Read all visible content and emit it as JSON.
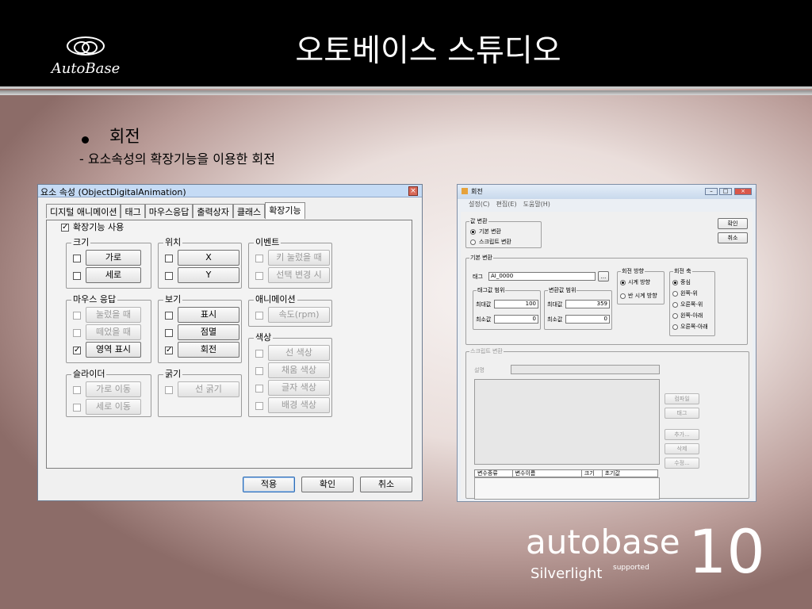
{
  "header": {
    "logo_text": "AutoBase",
    "title": "오토베이스 스튜디오"
  },
  "bullet": {
    "title": "회전",
    "subtitle": "- 요소속성의 확장기능을 이용한 회전"
  },
  "element_dialog": {
    "title": "요소 속성 (ObjectDigitalAnimation)",
    "close_icon": "close-icon",
    "tabs": [
      "디지털 애니메이션",
      "태그",
      "마우스응답",
      "출력상자",
      "클래스",
      "확장기능"
    ],
    "active_tab": "확장기능",
    "enable_extension": {
      "label": "확장기능 사용",
      "checked": true
    },
    "groups": {
      "size": {
        "title": "크기",
        "width": "가로",
        "height": "세로"
      },
      "position": {
        "title": "위치",
        "x": "X",
        "y": "Y"
      },
      "event": {
        "title": "이벤트",
        "key_press": "키 눌렀을 때",
        "selection_change": "선택 변경 시"
      },
      "mouse_response": {
        "title": "마우스 응답",
        "pressed": "눌렀을 때",
        "released": "떼었을 때",
        "area_display": "영역 표시"
      },
      "view": {
        "title": "보기",
        "display": "표시",
        "blink": "점멸",
        "rotate": "회전"
      },
      "animation": {
        "title": "애니메이션",
        "speed": "속도(rpm)"
      },
      "color": {
        "title": "색상",
        "line_color": "선 색상",
        "fill_color": "채움 색상",
        "text_color": "글자 색상",
        "background_color": "배경 색상"
      },
      "slider": {
        "title": "슬라이더",
        "horizontal_move": "가로 이동",
        "vertical_move": "세로 이동"
      },
      "thickness": {
        "title": "굵기",
        "line_thickness": "선 굵기"
      }
    },
    "buttons": {
      "apply": "적용",
      "ok": "확인",
      "cancel": "취소"
    }
  },
  "rotation_dialog": {
    "title": "회전",
    "menu": [
      "설정(C)",
      "편집(E)",
      "도움말(H)"
    ],
    "value_conversion": {
      "title": "값 변환",
      "basic": "기본 변환",
      "script": "스크립트 변환"
    },
    "buttons": {
      "ok": "확인",
      "cancel": "취소"
    },
    "basic_conversion": {
      "title": "기본 변환",
      "tag_label": "태그",
      "tag_value": "AI_0000",
      "browse": "...",
      "tag_range": {
        "title": "태그값 범위",
        "max_label": "최대값",
        "max_value": "100",
        "min_label": "최소값",
        "min_value": "0"
      },
      "convert_range": {
        "title": "변환값 범위",
        "max_label": "최대값",
        "max_value": "359",
        "min_label": "최소값",
        "min_value": "0"
      },
      "direction": {
        "title": "회전 방향",
        "clockwise": "시계 방향",
        "counterclockwise": "반 시계 방향"
      },
      "axis": {
        "title": "회전 축",
        "center": "중심",
        "left_top": "왼쪽-위",
        "right_top": "오른쪽-위",
        "left_bottom": "왼쪽-아래",
        "right_bottom": "오른쪽-아래"
      }
    },
    "script_conversion": {
      "title": "스크립트 변환",
      "desc_label": "설명",
      "compile": "컴파일",
      "tag": "태그",
      "add": "추가...",
      "delete": "삭제",
      "edit": "수정...",
      "columns": [
        "변수종류",
        "변수이름",
        "크기",
        "초기값"
      ]
    }
  },
  "brand": {
    "word": "autobase",
    "number": "10",
    "subtitle": "Silverlight",
    "superscript": "supported"
  }
}
